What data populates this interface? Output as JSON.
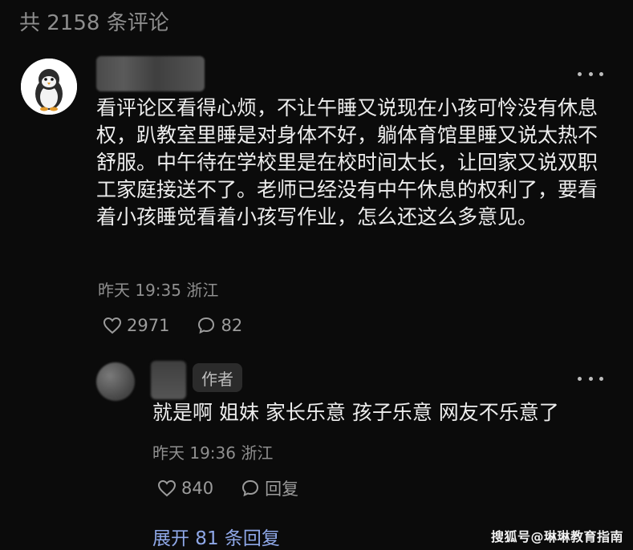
{
  "header": {
    "count_text": "共 2158 条评论"
  },
  "comment": {
    "text": "看评论区看得心烦，不让午睡又说现在小孩可怜没有休息权，趴教室里睡是对身体不好，躺体育馆里睡又说太热不舒服。中午待在学校里是在校时间太长，让回家又说双职工家庭接送不了。老师已经没有中午休息的权利了，要看着小孩睡觉看着小孩写作业，怎么还这么多意见。",
    "time_location": "昨天 19:35 浙江",
    "likes": "2971",
    "replies": "82"
  },
  "reply": {
    "badge": "作者",
    "text": "就是啊 姐妹 家长乐意 孩子乐意 网友不乐意了",
    "time_location": "昨天 19:36 浙江",
    "likes": "840",
    "reply_label": "回复"
  },
  "expand": {
    "label": "展开 81 条回复"
  },
  "watermark": {
    "text": "搜狐号@琳琳教育指南"
  },
  "icons": {
    "like": "heart-outline-icon",
    "comment": "speech-bubble-icon",
    "more": "more-horizontal-icon",
    "avatar": "penguin-avatar"
  },
  "colors": {
    "background": "#0b0b0b",
    "text": "#ededed",
    "muted": "#8f8f8f",
    "link": "#8fa8e8"
  }
}
